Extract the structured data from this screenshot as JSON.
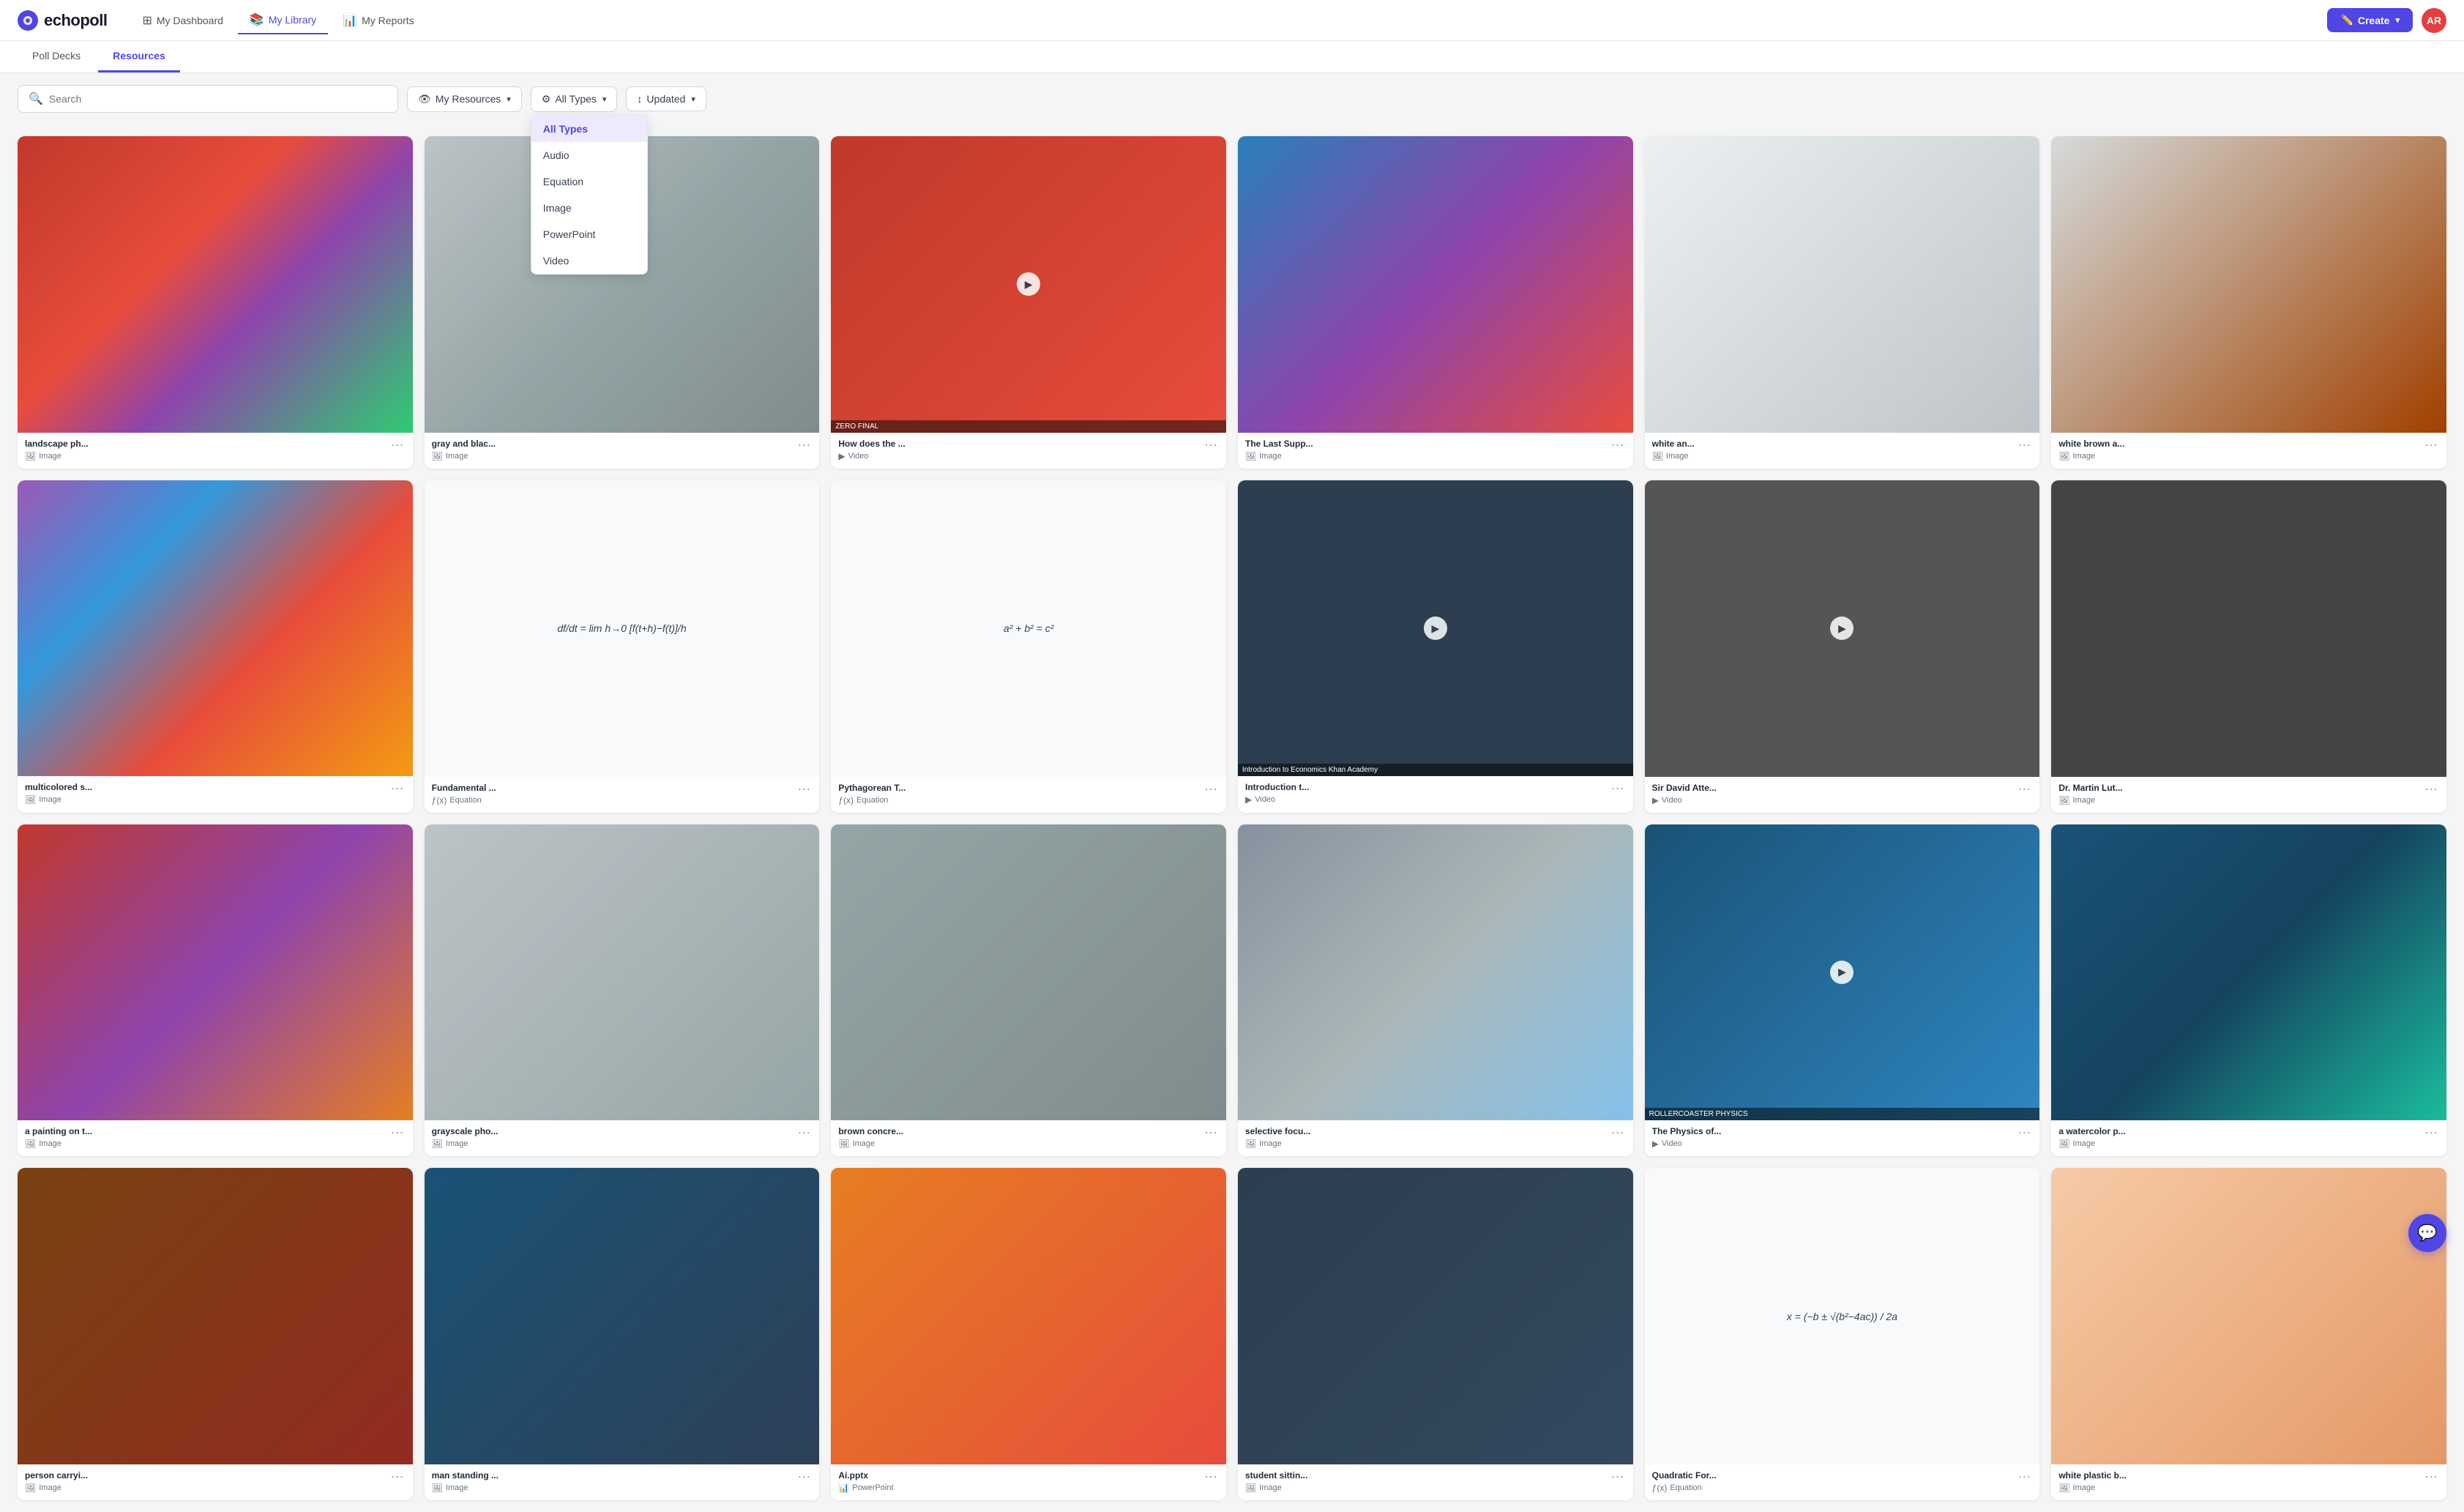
{
  "app": {
    "logo_text": "echopoll",
    "nav_items": [
      {
        "id": "dashboard",
        "label": "My Dashboard",
        "icon": "⊞",
        "active": false
      },
      {
        "id": "library",
        "label": "My Library",
        "icon": "📚",
        "active": true
      },
      {
        "id": "reports",
        "label": "My Reports",
        "icon": "📊",
        "active": false
      }
    ],
    "create_label": "Create",
    "avatar_initials": "AR"
  },
  "tabs": [
    {
      "id": "poll-decks",
      "label": "Poll Decks",
      "active": false
    },
    {
      "id": "resources",
      "label": "Resources",
      "active": true
    }
  ],
  "filters": {
    "search_placeholder": "Search",
    "my_resources_label": "My Resources",
    "all_types_label": "All Types",
    "updated_label": "Updated",
    "type_options": [
      {
        "id": "all",
        "label": "All Types",
        "selected": true
      },
      {
        "id": "audio",
        "label": "Audio",
        "selected": false
      },
      {
        "id": "equation",
        "label": "Equation",
        "selected": false
      },
      {
        "id": "image",
        "label": "Image",
        "selected": false
      },
      {
        "id": "powerpoint",
        "label": "PowerPoint",
        "selected": false
      },
      {
        "id": "video",
        "label": "Video",
        "selected": false
      }
    ]
  },
  "resources": [
    {
      "id": 1,
      "title": "landscape ph...",
      "type": "Image",
      "type_icon": "🖼",
      "thumb_class": "thumb-landscape"
    },
    {
      "id": 2,
      "title": "gray and blac...",
      "type": "Image",
      "type_icon": "🖼",
      "thumb_class": "thumb-gray"
    },
    {
      "id": 3,
      "title": "How does the ...",
      "type": "Video",
      "type_icon": "▶",
      "thumb_class": "thumb-video-red",
      "is_video": true
    },
    {
      "id": 4,
      "title": "The Last Supp...",
      "type": "Image",
      "type_icon": "🖼",
      "thumb_class": "thumb-stained"
    },
    {
      "id": 5,
      "title": "white an...",
      "type": "Image",
      "type_icon": "🖼",
      "thumb_class": "thumb-white-map"
    },
    {
      "id": 6,
      "title": "white brown a...",
      "type": "Image",
      "type_icon": "🖼",
      "thumb_class": "thumb-white-brown"
    },
    {
      "id": 7,
      "title": "multicolored s...",
      "type": "Image",
      "type_icon": "🖼",
      "thumb_class": "thumb-multicolor"
    },
    {
      "id": 8,
      "title": "Fundamental ...",
      "type": "Equation",
      "type_icon": "ƒ(x)",
      "thumb_class": "thumb-equation",
      "is_equation": true,
      "eq_text": "df/dt = lim h→0 [f(t+h)−f(t)]/h"
    },
    {
      "id": 9,
      "title": "Pythagorean T...",
      "type": "Equation",
      "type_icon": "ƒ(x)",
      "thumb_class": "thumb-pythagorean",
      "is_equation": true,
      "eq_text": "a² + b² = c²"
    },
    {
      "id": 10,
      "title": "Introduction t...",
      "type": "Video",
      "type_icon": "▶",
      "thumb_class": "thumb-economics",
      "is_video": true,
      "video_text": "Introduction to Economics — Khan Academy"
    },
    {
      "id": 11,
      "title": "Sir David Atte...",
      "type": "Video",
      "type_icon": "▶",
      "thumb_class": "thumb-attenborough",
      "is_video": true
    },
    {
      "id": 12,
      "title": "Dr. Martin Lut...",
      "type": "Image",
      "type_icon": "🖼",
      "thumb_class": "thumb-martin"
    },
    {
      "id": 13,
      "title": "a painting on t...",
      "type": "Image",
      "type_icon": "🖼",
      "thumb_class": "thumb-painting"
    },
    {
      "id": 14,
      "title": "grayscale pho...",
      "type": "Image",
      "type_icon": "🖼",
      "thumb_class": "thumb-grayscale"
    },
    {
      "id": 15,
      "title": "brown concre...",
      "type": "Image",
      "type_icon": "🖼",
      "thumb_class": "thumb-concrete"
    },
    {
      "id": 16,
      "title": "selective focu...",
      "type": "Image",
      "type_icon": "🖼",
      "thumb_class": "thumb-quokka"
    },
    {
      "id": 17,
      "title": "The Physics of...",
      "type": "Video",
      "type_icon": "▶",
      "thumb_class": "thumb-physics",
      "is_video": true,
      "video_text": "ROLLERCOASTER PHYSICS"
    },
    {
      "id": 18,
      "title": "a watercolor p...",
      "type": "Image",
      "type_icon": "🖼",
      "thumb_class": "thumb-watercolor"
    },
    {
      "id": 19,
      "title": "person carryi...",
      "type": "Image",
      "type_icon": "🖼",
      "thumb_class": "thumb-person"
    },
    {
      "id": 20,
      "title": "man standing ...",
      "type": "Image",
      "type_icon": "🖼",
      "thumb_class": "thumb-man-standing"
    },
    {
      "id": 21,
      "title": "Ai.pptx",
      "type": "PowerPoint",
      "type_icon": "📊",
      "thumb_class": "thumb-ai-pptx"
    },
    {
      "id": 22,
      "title": "student sittin...",
      "type": "Image",
      "type_icon": "🖼",
      "thumb_class": "thumb-student"
    },
    {
      "id": 23,
      "title": "Quadratic For...",
      "type": "Equation",
      "type_icon": "ƒ(x)",
      "thumb_class": "thumb-quadratic",
      "is_equation": true,
      "eq_text": "x = (−b ± √(b²−4ac)) / 2a"
    },
    {
      "id": 24,
      "title": "white plastic b...",
      "type": "Image",
      "type_icon": "🖼",
      "thumb_class": "thumb-white-plastic"
    }
  ]
}
